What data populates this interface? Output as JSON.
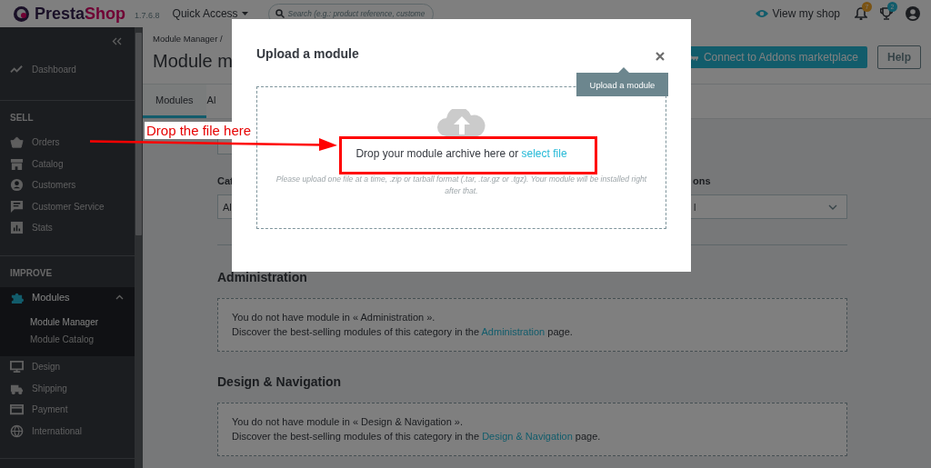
{
  "header": {
    "logo": "PrestaShop",
    "version": "1.7.6.8",
    "quick_access": "Quick Access",
    "search": {
      "placeholder": "Search (e.g.: product reference, custome"
    },
    "view_shop": "View my shop",
    "notifications": [
      {
        "kind": "bell",
        "count": "7",
        "color": "#7a5313"
      },
      {
        "kind": "trophy",
        "count": "2",
        "color": "#125c6b"
      }
    ]
  },
  "sidebar": {
    "groups": [
      {
        "items": [
          {
            "label": "Dashboard",
            "selected": false
          }
        ]
      },
      {
        "heading": "SELL",
        "items": [
          {
            "label": "Orders",
            "selected": false
          },
          {
            "label": "Catalog",
            "selected": false
          },
          {
            "label": "Customers",
            "selected": false
          },
          {
            "label": "Customer Service",
            "selected": false
          },
          {
            "label": "Stats",
            "selected": false
          }
        ]
      },
      {
        "heading": "IMPROVE",
        "items": [
          {
            "label": "Modules",
            "selected": true,
            "expanded": true,
            "children": [
              {
                "label": "Module Manager",
                "selected": true
              },
              {
                "label": "Module Catalog",
                "selected": false
              }
            ]
          },
          {
            "label": "Design",
            "selected": false
          },
          {
            "label": "Shipping",
            "selected": false
          },
          {
            "label": "Payment",
            "selected": false
          },
          {
            "label": "International",
            "selected": false
          }
        ]
      }
    ]
  },
  "page": {
    "breadcrumb": "Module Manager /",
    "title": "Module m",
    "buttons": [
      {
        "kind": "primary",
        "label": "Connect to Addons marketplace"
      },
      {
        "kind": "secondary",
        "label": "Help"
      }
    ],
    "tabs": [
      {
        "label": "Modules",
        "selected": true
      },
      {
        "label": "Al",
        "selected": false
      }
    ],
    "filters": [
      {
        "label": "Cat",
        "value": "Al"
      },
      {
        "label": "ons",
        "value": "l"
      }
    ],
    "sections": [
      {
        "title": "Administration",
        "message": "You do not have module in « Administration ».",
        "discover": "Discover the best-selling modules of this category in the",
        "link": "Administration",
        "after": "page."
      },
      {
        "title": "Design & Navigation",
        "message": "You do not have module in « Design & Navigation ».",
        "discover": "Discover the best-selling modules of this category in the",
        "link": "Design & Navigation",
        "after": "page."
      }
    ]
  },
  "modal": {
    "title": "Upload a module",
    "tooltip": "Upload a module",
    "drop_text": "Drop your module archive here or",
    "select_link": "select file",
    "hint": "Please upload one file at a time, .zip or tarball format (.tar, .tar.gz or .tgz). Your module will be installed right after that."
  },
  "annotation": {
    "label": "Drop the file here"
  }
}
